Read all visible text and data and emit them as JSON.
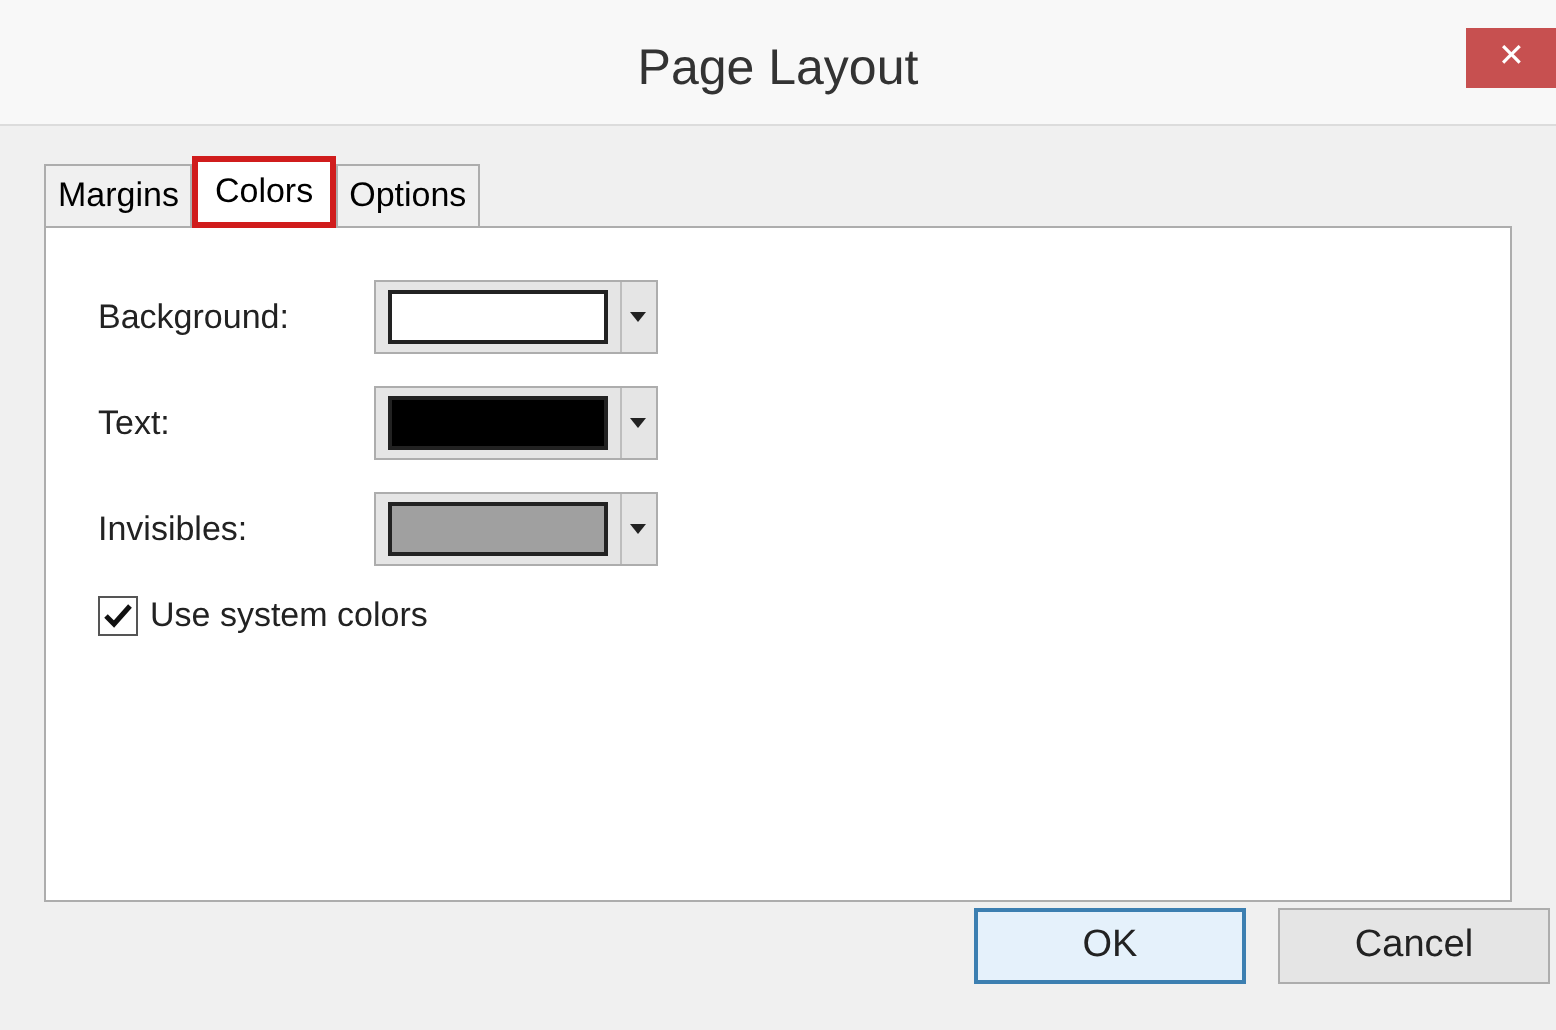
{
  "window": {
    "title": "Page Layout",
    "close": "✕"
  },
  "tabs": [
    {
      "label": "Margins",
      "selected": false
    },
    {
      "label": "Colors",
      "selected": true
    },
    {
      "label": "Options",
      "selected": false
    }
  ],
  "colors": [
    {
      "label": "Background:",
      "color": "#ffffff"
    },
    {
      "label": "Text:",
      "color": "#000000"
    },
    {
      "label": "Invisibles:",
      "color": "#a0a0a0"
    }
  ],
  "use_system_colors": {
    "label": "Use system colors",
    "checked": true
  },
  "buttons": [
    {
      "label": "OK",
      "kind": "default"
    },
    {
      "label": "Cancel",
      "kind": "normal"
    }
  ]
}
